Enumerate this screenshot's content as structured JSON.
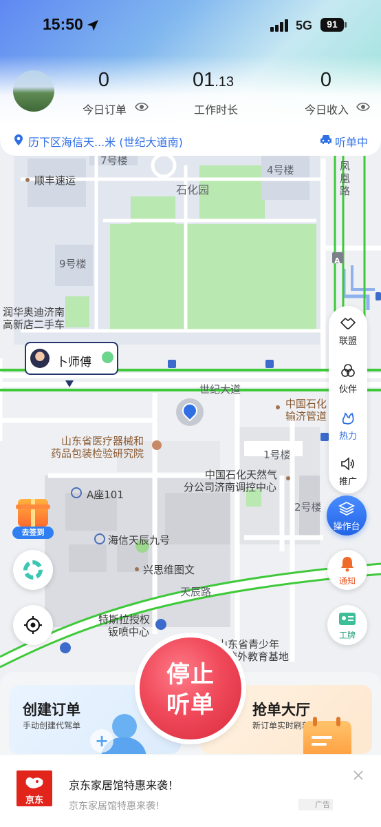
{
  "status_bar": {
    "time": "15:50",
    "network": "5G",
    "battery": "91"
  },
  "stats": [
    {
      "value": "0",
      "label": "今日订单"
    },
    {
      "value_main": "01",
      "value_small": ".13",
      "label": "工作时长"
    },
    {
      "value": "0",
      "label": "今日收入"
    }
  ],
  "location": {
    "address": "历下区海信天...米 (世纪大道南)",
    "status": "听单中"
  },
  "map": {
    "labels": {
      "l7": "7号楼",
      "shunfeng": "顺丰速运",
      "shihua_park": "石化园",
      "l4": "4号楼",
      "fenghuang": "凤凰路",
      "l9": "9号楼",
      "runhua1": "润华奥迪济南",
      "runhua2": "高新店二手车",
      "shiji": "世纪大道",
      "zhongguo_shihua1": "中国石化",
      "zhongguo_shihua2": "输济管道",
      "sd_yiliao1": "山东省医疗器械和",
      "sd_yiliao2": "药品包装检验研究院",
      "l1": "1号楼",
      "zhongguo_tianran1": "中国石化天然气",
      "zhongguo_tianran2": "分公司济南调控中心",
      "a101": "A座101",
      "l2": "2号楼",
      "haixin": "海信天辰九号",
      "xingsi": "兴思维图文",
      "tianchen": "天辰路",
      "tesla1": "特斯拉授权",
      "tesla2": "钣喷中心",
      "sd_qingshao1": "山东省青少年",
      "sd_qingshao2": "校外教育基地",
      "bus_a": "A"
    },
    "driver_name": "卜师傅",
    "checkin": "去签到"
  },
  "side_panel": {
    "items": [
      {
        "label": "联盟",
        "icon": "handshake-icon"
      },
      {
        "label": "伙伴",
        "icon": "partner-icon"
      },
      {
        "label": "热力",
        "icon": "heat-icon"
      },
      {
        "label": "推广",
        "icon": "speaker-icon"
      }
    ],
    "console": "操作台",
    "notify": "通知",
    "badge": "工牌"
  },
  "cards": {
    "create": {
      "title": "创建订单",
      "subtitle": "手动创建代驾单"
    },
    "grab": {
      "title": "抢单大厅",
      "subtitle": "新订单实时刷新"
    }
  },
  "stop_button": {
    "line1": "停止",
    "line2": "听单"
  },
  "ad": {
    "brand": "京东",
    "title": "京东家居馆特惠来袭！",
    "subtitle": "京东家居馆特惠来袭!",
    "tag": "广告"
  },
  "colors": {
    "accent": "#2f6fe6",
    "road_green": "#3fc93a",
    "stop_red": "#e8394b",
    "card_blue": "#e4f1fd",
    "card_orange": "#fdf1e3"
  }
}
